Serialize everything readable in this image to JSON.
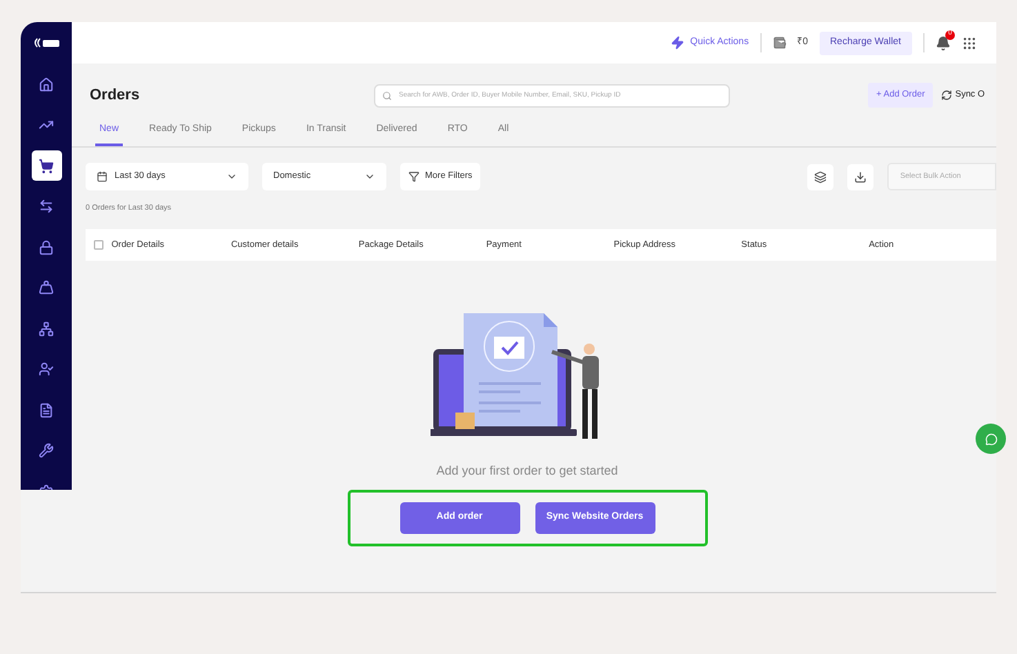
{
  "sidebar": {
    "items": [
      {
        "selected": false
      },
      {
        "selected": false
      },
      {
        "selected": true
      },
      {
        "selected": false
      },
      {
        "selected": false
      },
      {
        "selected": false
      },
      {
        "selected": false
      },
      {
        "selected": false
      },
      {
        "selected": false
      },
      {
        "selected": false
      },
      {
        "selected": false
      }
    ]
  },
  "top_bar": {
    "quick_actions": "Quick Actions",
    "wallet_balance": "₹0",
    "recharge_button": "Recharge Wallet",
    "notification_count": "0"
  },
  "page": {
    "title": "Orders",
    "search": {
      "placeholder": "Search for AWB, Order ID, Buyer Mobile Number, Email, SKU, Pickup ID"
    },
    "add_order_button": "+ Add Order",
    "sync_button": "Sync O"
  },
  "tabs": [
    {
      "label": "New",
      "selected": true
    },
    {
      "label": "Ready To Ship",
      "selected": false
    },
    {
      "label": "Pickups",
      "selected": false
    },
    {
      "label": "In Transit",
      "selected": false
    },
    {
      "label": "Delivered",
      "selected": false
    },
    {
      "label": "RTO",
      "selected": false
    },
    {
      "label": "All",
      "selected": false
    }
  ],
  "filters": {
    "date_range": "Last 30 days",
    "shipment_type": "Domestic",
    "more_filters": "More Filters",
    "bulk_action": {
      "placeholder": "Select Bulk Action"
    }
  },
  "order_count": "0 Orders for Last 30 days",
  "table": {
    "select_all_checked": false,
    "columns": [
      "Order Details",
      "Customer details",
      "Package Details",
      "Payment",
      "Pickup Address",
      "Status",
      "Action"
    ]
  },
  "empty_state": {
    "message": "Add your first order to get started",
    "buttons": [
      "Add order",
      "Sync Website Orders"
    ]
  }
}
